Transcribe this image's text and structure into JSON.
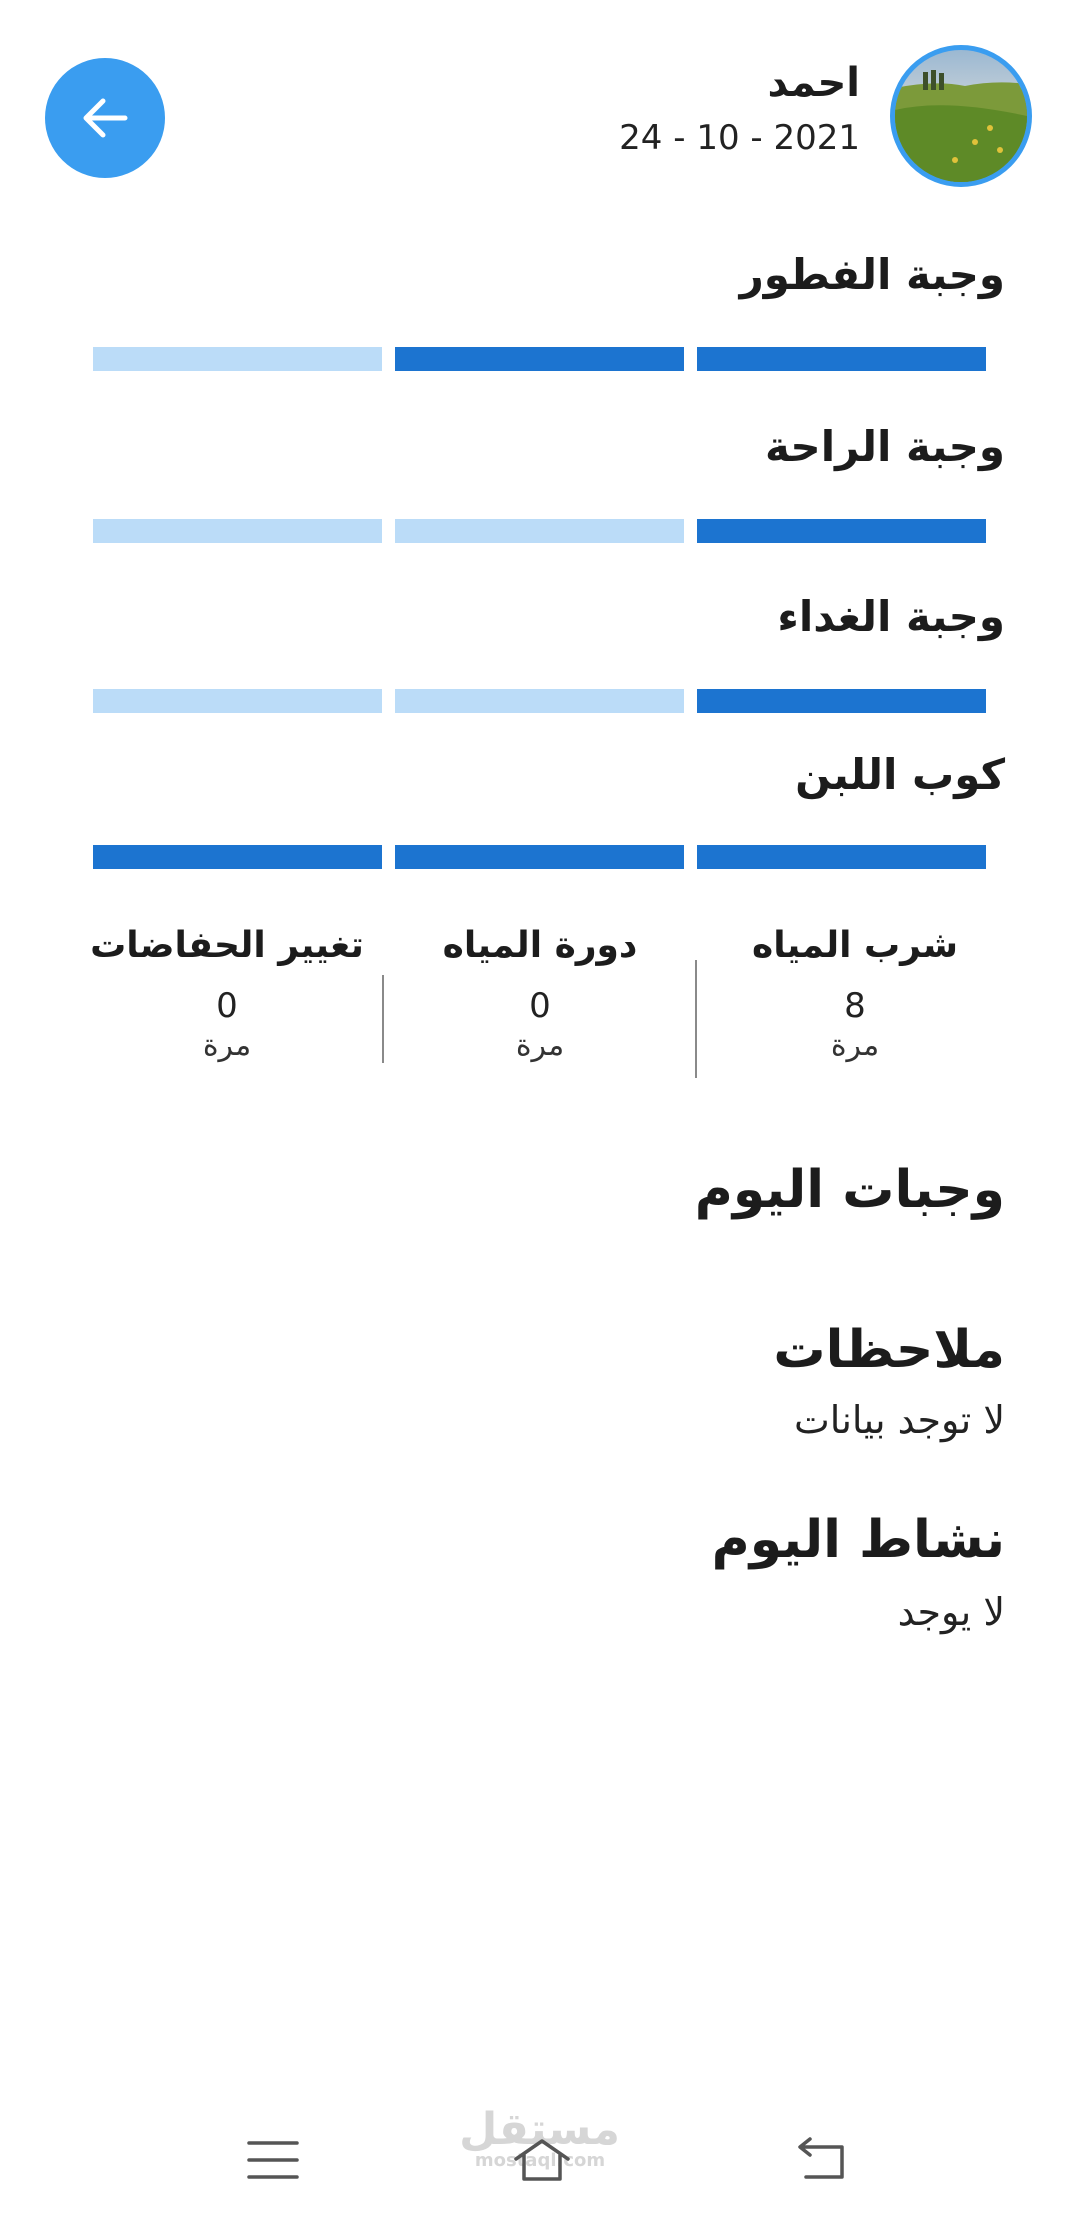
{
  "header": {
    "name": "احمد",
    "date": "24 - 10 - 2021",
    "back_icon": "arrow-left-icon"
  },
  "meals": [
    {
      "title": "وجبة الفطور",
      "progress": [
        true,
        true,
        false
      ]
    },
    {
      "title": "وجبة الراحة",
      "progress": [
        true,
        false,
        false
      ]
    },
    {
      "title": "وجبة الغداء",
      "progress": [
        true,
        false,
        false
      ]
    },
    {
      "title": "كوب اللبن",
      "progress": [
        true,
        true,
        true
      ]
    }
  ],
  "stats": [
    {
      "label": "شرب المياه",
      "value": "8",
      "unit": "مرة"
    },
    {
      "label": "دورة المياه",
      "value": "0",
      "unit": "مرة"
    },
    {
      "label": "تغيير الحفاضات",
      "value": "0",
      "unit": "مرة"
    }
  ],
  "sections": {
    "today_meals_title": "وجبات اليوم",
    "notes_title": "ملاحظات",
    "notes_text": "لا توجد بيانات",
    "activity_title": "نشاط اليوم",
    "activity_text": "لا يوجد"
  },
  "watermark": {
    "arabic": "مستقل",
    "latin": "mostaql.com"
  },
  "colors": {
    "accent": "#3a9df0",
    "bar_on": "#1c74d0",
    "bar_off": "#bbdcf8"
  },
  "nav": {
    "menu_icon": "menu-icon",
    "home_icon": "home-icon",
    "back_icon": "back-icon"
  }
}
